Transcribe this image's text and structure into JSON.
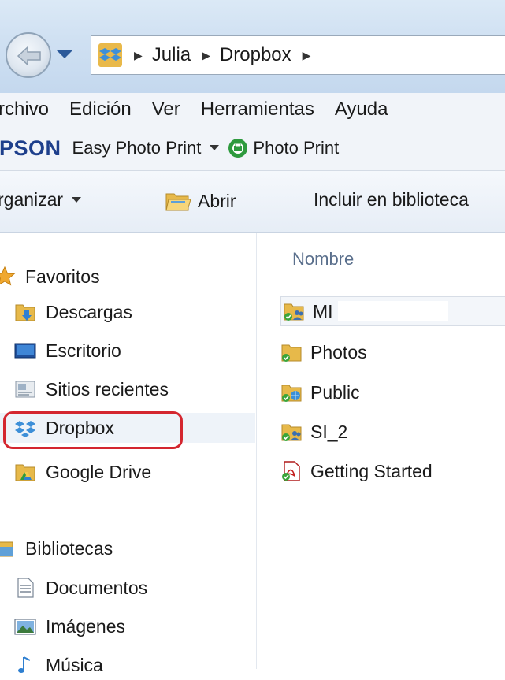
{
  "address_bar": {
    "breadcrumbs": [
      "Julia",
      "Dropbox"
    ],
    "location_icon": "dropbox-icon"
  },
  "menu": {
    "items": [
      "rchivo",
      "Edición",
      "Ver",
      "Herramientas",
      "Ayuda"
    ]
  },
  "epson_toolbar": {
    "brand": "PSON",
    "easy_photo_print": "Easy Photo Print",
    "photo_print": "Photo Print"
  },
  "command_bar": {
    "organize": "rganizar",
    "open": "Abrir",
    "include_in_library": "Incluir en biblioteca"
  },
  "nav_pane": {
    "favorites_label": "Favoritos",
    "favorites": [
      {
        "label": "Descargas",
        "icon": "downloads-folder-icon"
      },
      {
        "label": "Escritorio",
        "icon": "desktop-icon"
      },
      {
        "label": "Sitios recientes",
        "icon": "recent-places-icon"
      },
      {
        "label": "Dropbox",
        "icon": "dropbox-icon"
      },
      {
        "label": "Google Drive",
        "icon": "google-drive-icon"
      }
    ],
    "libraries_label": "Bibliotecas",
    "libraries": [
      {
        "label": "Documentos",
        "icon": "documents-icon"
      },
      {
        "label": "Imágenes",
        "icon": "pictures-icon"
      },
      {
        "label": "Música",
        "icon": "music-icon"
      }
    ]
  },
  "content": {
    "column_name": "Nombre",
    "files": [
      {
        "name": "MI",
        "icon": "shared-folder-synced-icon"
      },
      {
        "name": "Photos",
        "icon": "folder-synced-icon"
      },
      {
        "name": "Public",
        "icon": "public-folder-synced-icon"
      },
      {
        "name": "SI_2",
        "icon": "shared-folder-synced-icon"
      },
      {
        "name": "Getting Started",
        "icon": "pdf-synced-icon"
      }
    ]
  },
  "colors": {
    "highlight_ring": "#d4262f",
    "epson_brand": "#1e3f8c",
    "selection_bg": "#eef3f9"
  }
}
